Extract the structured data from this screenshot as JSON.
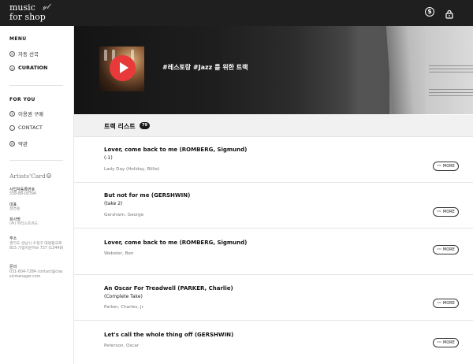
{
  "brand": {
    "line1": "music",
    "line2": "for shop",
    "signature": "𝓎𝓁"
  },
  "topbar": {
    "coin_icon": "coin-icon",
    "coin_glyph": "$",
    "bag_icon": "lock-bag-icon"
  },
  "sidebar": {
    "menu_title": "MENU",
    "menu_items": [
      {
        "label": "자동 선곡",
        "icon": "auto-select-icon",
        "glyph": "⟳",
        "active": false
      },
      {
        "label": "CURATION",
        "icon": "curation-icon",
        "glyph": "◎",
        "active": true
      }
    ],
    "foryou_title": "FOR YOU",
    "foryou_items": [
      {
        "label": "이용권 구매",
        "icon": "coin-icon",
        "glyph": "$"
      },
      {
        "label": "CONTACT",
        "icon": "chat-icon",
        "glyph": "…"
      },
      {
        "label": "약관",
        "icon": "settings-icon",
        "glyph": "⚙"
      }
    ],
    "artists_card": "Artists'Card",
    "artists_card_mark": "R",
    "info": [
      {
        "label": "사업자등록번호",
        "value": "558-88-00394"
      },
      {
        "label": "대표",
        "value": "정연승"
      },
      {
        "label": "회사명",
        "value": "(주) 아티스츠카드"
      },
      {
        "label": "주소",
        "value": "경기도 성남시 수정구 대왕판교로 815 기업지원허브 737 (13449)"
      },
      {
        "label": "문의",
        "value": "031-604-7284 contact@classicmanager.com"
      }
    ]
  },
  "hero": {
    "title": "#레스토랑 #Jazz 를 위한 트랙"
  },
  "tracklist": {
    "title": "트랙 리스트",
    "count": "79",
    "more_label": "MORE",
    "more_dots": "···",
    "tracks": [
      {
        "title": "Lover, come back to me (ROMBERG, Sigmund)",
        "subtitle": "(-1)",
        "artist": "Lady Day (Holiday, Billie)"
      },
      {
        "title": "But not for me (GERSHWIN)",
        "subtitle": "(take 2)",
        "artist": "Gershwin, George"
      },
      {
        "title": "Lover, come back to me (ROMBERG, Sigmund)",
        "subtitle": "",
        "artist": "Webster, Ben"
      },
      {
        "title": "An Oscar For Treadwell (PARKER, Charlie)",
        "subtitle": "(Complete Take)",
        "artist": "Parker, Charles, Jr."
      },
      {
        "title": "Let's call the whole thing off (GERSHWIN)",
        "subtitle": "",
        "artist": "Peterson, Oscar"
      }
    ]
  }
}
